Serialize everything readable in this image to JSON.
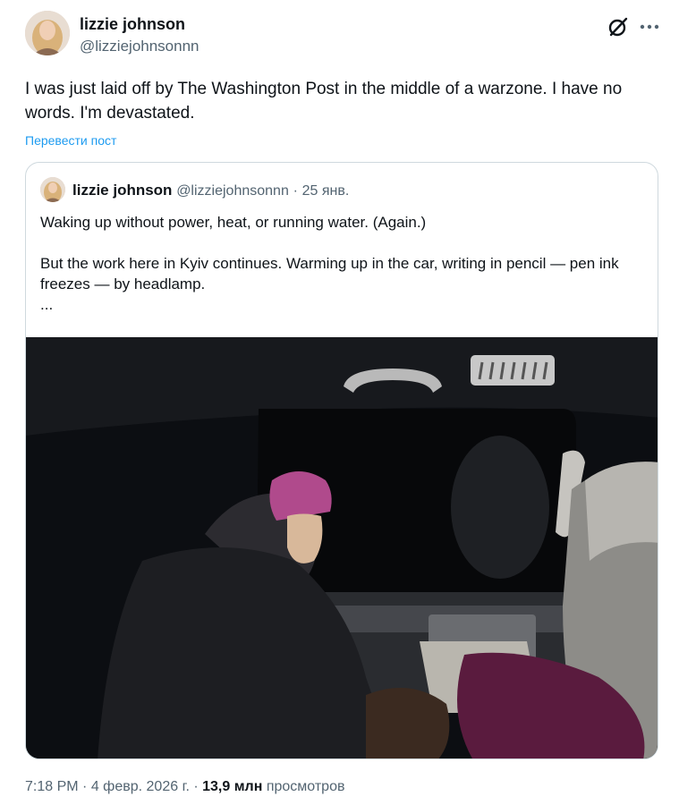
{
  "author": {
    "name": "lizzie johnson",
    "handle": "@lizziejohnsonnn"
  },
  "icons": {
    "grok": "grok-slash-icon",
    "more": "more-dots-icon"
  },
  "tweet": {
    "text": "I was just laid off by The Washington Post in the middle of a warzone. I have no words. I'm devastated.",
    "translate_label": "Перевести пост"
  },
  "quoted_tweet": {
    "name": "lizzie johnson",
    "handle": "@lizziejohnsonnn",
    "separator": "·",
    "date": "25 янв.",
    "line1": "Waking up without power, heat, or running water. (Again.)",
    "line2": "But the work here in Kyiv continues. Warming up in the car, writing in pencil — pen ink freezes — by headlamp.",
    "line3": "..."
  },
  "meta": {
    "time": "7:18 PM",
    "separator": "·",
    "date": "4 февр. 2026 г.",
    "views_count": "13,9 млн",
    "views_label": "просмотров"
  },
  "colors": {
    "link": "#1d9bf0",
    "secondary_text": "#536471",
    "border": "#cfd9de"
  }
}
